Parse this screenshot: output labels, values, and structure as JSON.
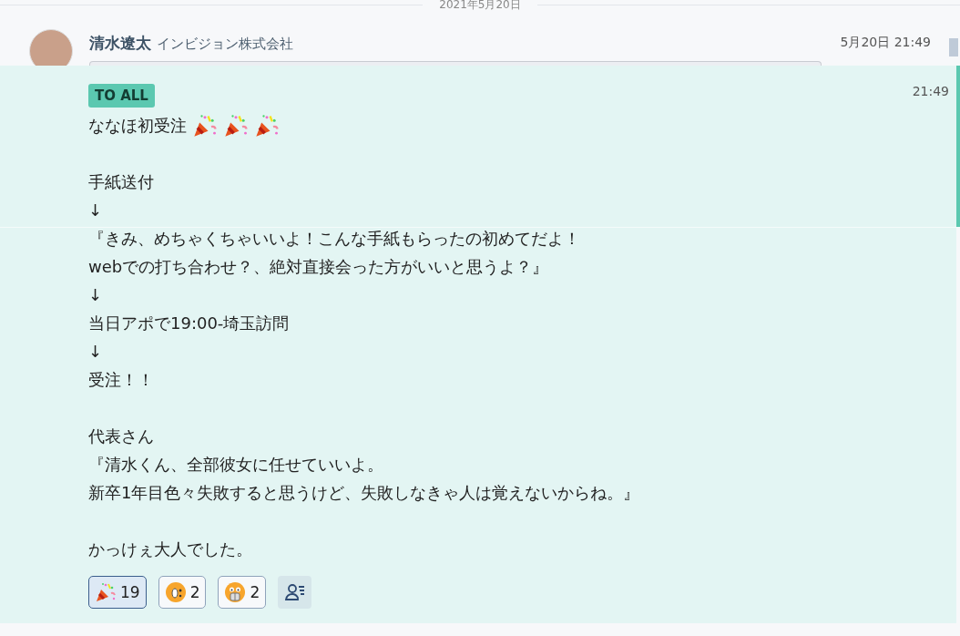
{
  "date_divider": "2021年5月20日",
  "post": {
    "author": "清水遼太",
    "company": "インビジョン株式会社",
    "timestamp": "5月20日 21:49"
  },
  "reply": {
    "badge": "TO ALL",
    "time": "21:49",
    "paragraphs": [
      [
        {
          "kind": "celebration",
          "text": "ななほ初受注"
        }
      ],
      [
        {
          "kind": "plain",
          "text": "手紙送付"
        },
        {
          "kind": "plain",
          "text": "↓"
        },
        {
          "kind": "plain",
          "text": "『きみ、めちゃくちゃいいよ！こんな手紙もらったの初めてだよ！"
        },
        {
          "kind": "plain",
          "text": "webでの打ち合わせ？、絶対直接会った方がいいと思うよ？』"
        },
        {
          "kind": "plain",
          "text": "↓"
        },
        {
          "kind": "plain",
          "text": "当日アポで19:00-埼玉訪問"
        },
        {
          "kind": "plain",
          "text": "↓"
        },
        {
          "kind": "plain",
          "text": "受注！！"
        }
      ],
      [
        {
          "kind": "plain",
          "text": "代表さん"
        },
        {
          "kind": "plain",
          "text": "『清水くん、全部彼女に任せていいよ。"
        },
        {
          "kind": "plain",
          "text": "新卒1年目色々失敗すると思うけど、失敗しなきゃ人は覚えないからね。』"
        }
      ],
      [
        {
          "kind": "plain",
          "text": "かっけぇ大人でした。"
        }
      ]
    ],
    "reactions": [
      {
        "kind": "popper",
        "count": "19",
        "selected": true
      },
      {
        "kind": "surprised",
        "count": "2",
        "selected": false
      },
      {
        "kind": "scared",
        "count": "2",
        "selected": false
      }
    ]
  }
}
